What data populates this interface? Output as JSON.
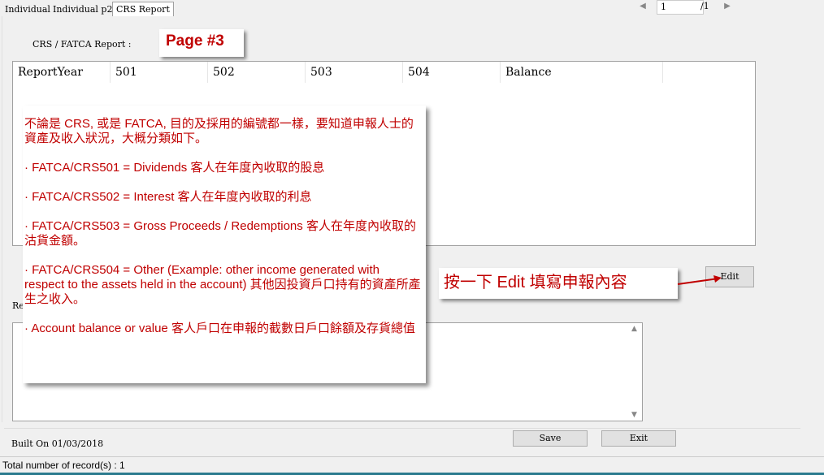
{
  "tabs": [
    {
      "label": "Individual",
      "active": false
    },
    {
      "label": "Individual  p2",
      "active": false
    },
    {
      "label": "CRS Report",
      "active": true
    }
  ],
  "navigator": {
    "page_value": "1",
    "page_total": "/1"
  },
  "report": {
    "title": "CRS / FATCA Report :",
    "page_badge": "Page #3"
  },
  "grid": {
    "columns": [
      "ReportYear",
      "501",
      "502",
      "503",
      "504",
      "Balance"
    ]
  },
  "callout": {
    "intro": "不論是 CRS, 或是 FATCA, 目的及採用的編號都一樣，要知道申報人士的資產及收入狀況，大概分類如下。",
    "items": [
      "· FATCA/CRS501  = Dividends 客人在年度內收取的股息",
      "· FATCA/CRS502  =  Interest  客人在年度內收取的利息",
      "· FATCA/CRS503 = Gross Proceeds / Redemptions 客人在年度內收取的沽貨金額。",
      "· FATCA/CRS504 = Other (Example: other income generated with respect to the assets held in the account) 其他因投資戶口持有的資產所產生之收入。",
      "· Account  balance  or  value  客人戶口在申報的截數日戶口餘額及存貨總值"
    ]
  },
  "edit_callout": "按一下 Edit 填寫申報內容",
  "buttons": {
    "edit": "Edit",
    "save": "Save",
    "exit": "Exit"
  },
  "remarks_label": "Re",
  "built_on": "Built On  01/03/2018",
  "status": "Total number of record(s) : 1",
  "colors": {
    "accent_red": "#c00000",
    "strip": "#2b7b8e"
  }
}
